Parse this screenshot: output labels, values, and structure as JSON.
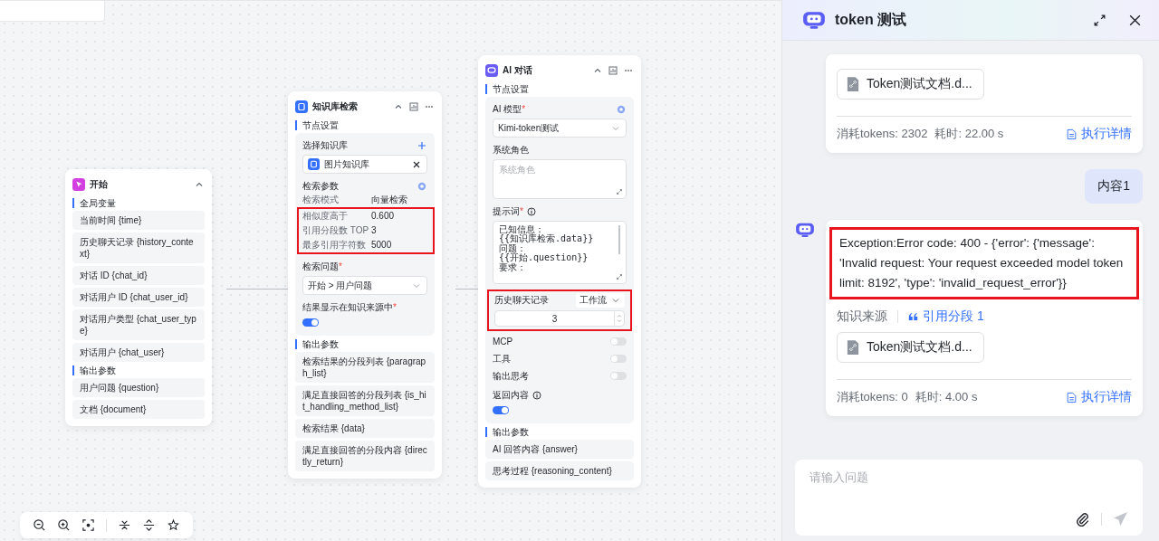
{
  "start_node": {
    "title": "开始",
    "sections": [
      {
        "title": "全局变量",
        "fields": [
          "当前时间 {time}",
          "历史聊天记录 {history_context}",
          "对话 ID {chat_id}",
          "对话用户 ID {chat_user_id}",
          "对话用户类型 {chat_user_type}",
          "对话用户 {chat_user}"
        ]
      },
      {
        "title": "输出参数",
        "fields": [
          "用户问题 {question}",
          "文档 {document}"
        ]
      }
    ]
  },
  "kb_node": {
    "title": "知识库检索",
    "settings_title": "节点设置",
    "select_label": "选择知识库",
    "selected_kb": "图片知识库",
    "params_title": "检索参数",
    "params": [
      {
        "label": "检索模式",
        "value": "向量检索",
        "highlighted": false
      },
      {
        "label": "相似度高于",
        "value": "0.600",
        "highlighted": true
      },
      {
        "label": "引用分段数 TOP",
        "value": "3",
        "highlighted": true
      },
      {
        "label": "最多引用字符数",
        "value": "5000",
        "highlighted": true
      }
    ],
    "question_label": "检索问题",
    "question_mark": "*",
    "question_value": "开始 > 用户问题",
    "source_label": "结果显示在知识来源中",
    "source_mark": "*",
    "source_on": true,
    "output_title": "输出参数",
    "outputs": [
      "检索结果的分段列表 {paragraph_list}",
      "满足直接回答的分段列表 {is_hit_handling_method_list}",
      "检索结果 {data}",
      "满足直接回答的分段内容 {directly_return}"
    ]
  },
  "ai_node": {
    "title": "AI 对话",
    "settings_title": "节点设置",
    "model_label": "AI 模型",
    "model_mark": "*",
    "model_value": "Kimi-token测试",
    "system_label": "系统角色",
    "system_placeholder": "系统角色",
    "prompt_label": "提示词",
    "prompt_mark": "*",
    "prompt_lines": [
      "已知信息：",
      "{{知识库检索.data}}",
      "问题：",
      "{{开始.question}}",
      "要求："
    ],
    "history": {
      "label": "历史聊天记录",
      "mode": "工作流",
      "count": "3",
      "highlighted": true
    },
    "toggles": [
      {
        "label": "MCP",
        "on": false
      },
      {
        "label": "工具",
        "on": false
      },
      {
        "label": "输出思考",
        "on": false
      }
    ],
    "return_label": "返回内容",
    "return_on": true,
    "output_title": "输出参数",
    "outputs": [
      "AI 回答内容 {answer}",
      "思考过程 {reasoning_content}"
    ]
  },
  "chat_panel": {
    "title": "token 测试",
    "messages": [
      {
        "kind": "bot",
        "avatar": false,
        "files": [
          "Token测试文档.d..."
        ],
        "tokens": "消耗tokens: 2302",
        "time": "耗时: 22.00 s",
        "detail_link": "执行详情"
      },
      {
        "kind": "user",
        "text": "内容1"
      },
      {
        "kind": "bot",
        "avatar": true,
        "text": "Exception:Error code: 400 - {'error': {'message': 'Invalid request: Your request exceeded model token limit: 8192', 'type': 'invalid_request_error'}}",
        "highlighted": true,
        "source_label": "知识来源",
        "citation": "引用分段 1",
        "files": [
          "Token测试文档.d..."
        ],
        "tokens": "消耗tokens: 0",
        "time": "耗时: 4.00 s",
        "detail_link": "执行详情"
      }
    ],
    "input_placeholder": "请输入问题"
  }
}
